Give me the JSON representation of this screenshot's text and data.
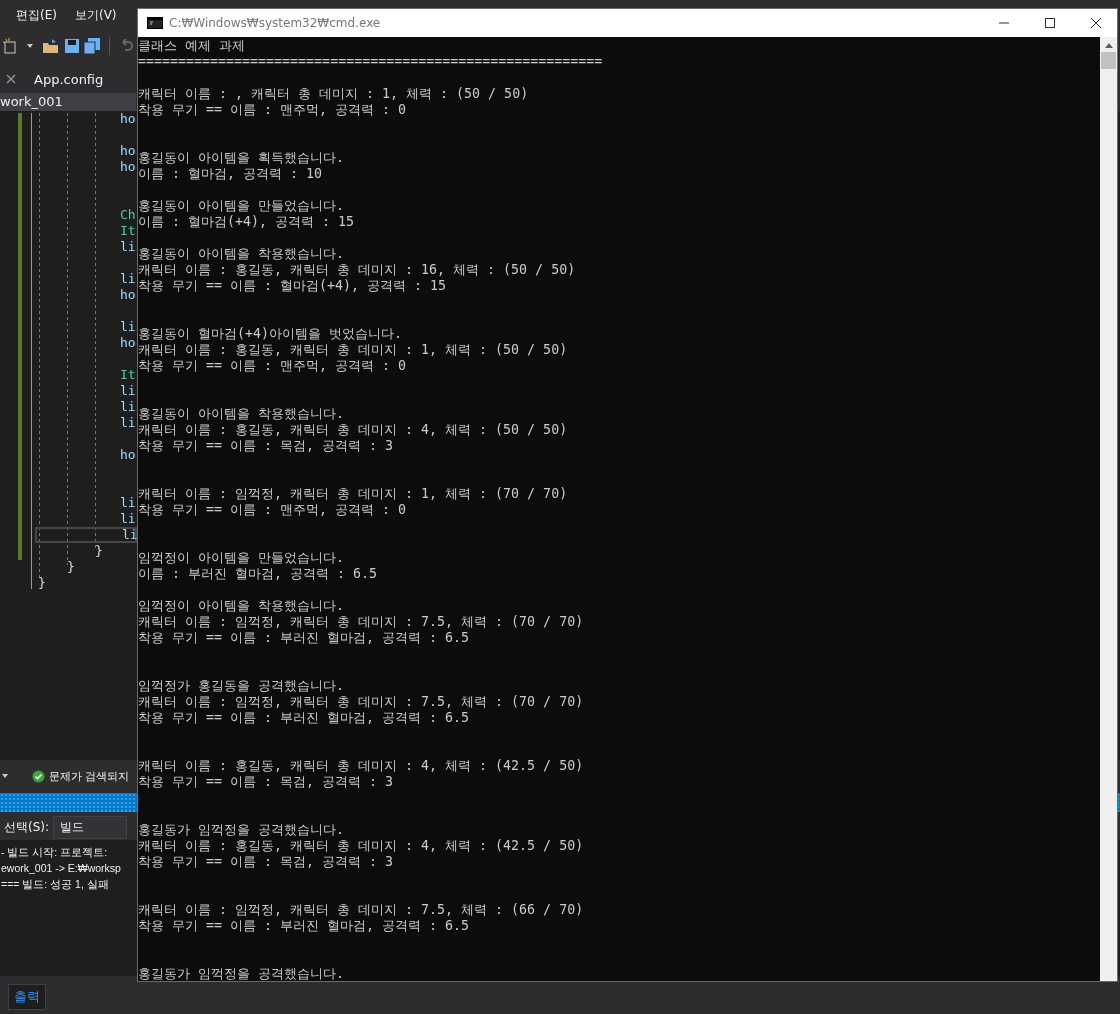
{
  "ide": {
    "menu": [
      "편집(E)",
      "보기(V)"
    ],
    "tabs": [
      {
        "label": "App.config",
        "selected": false
      }
    ],
    "project": "work_001",
    "code_lines": [
      {
        "kind": "ident",
        "text": "ho",
        "current": false
      },
      {
        "kind": "blank",
        "current": false
      },
      {
        "kind": "ident",
        "text": "ho",
        "current": false
      },
      {
        "kind": "ident",
        "text": "ho",
        "current": false
      },
      {
        "kind": "blank",
        "current": false
      },
      {
        "kind": "blank",
        "current": false
      },
      {
        "kind": "type",
        "text": "Ch",
        "current": false
      },
      {
        "kind": "type",
        "text": "It",
        "current": false
      },
      {
        "kind": "ident",
        "text": "li",
        "current": false
      },
      {
        "kind": "blank",
        "current": false
      },
      {
        "kind": "ident",
        "text": "li",
        "current": false
      },
      {
        "kind": "ident",
        "text": "ho",
        "current": false
      },
      {
        "kind": "blank",
        "current": false
      },
      {
        "kind": "ident",
        "text": "li",
        "current": false
      },
      {
        "kind": "ident",
        "text": "ho",
        "current": false
      },
      {
        "kind": "blank",
        "current": false
      },
      {
        "kind": "type",
        "text": "It",
        "current": false
      },
      {
        "kind": "ident",
        "text": "li",
        "current": false
      },
      {
        "kind": "ident",
        "text": "li",
        "current": false
      },
      {
        "kind": "ident",
        "text": "li",
        "current": false
      },
      {
        "kind": "blank",
        "current": false
      },
      {
        "kind": "ident",
        "text": "ho",
        "current": false
      },
      {
        "kind": "blank",
        "current": false
      },
      {
        "kind": "blank",
        "current": false
      },
      {
        "kind": "ident",
        "text": "li",
        "current": false
      },
      {
        "kind": "ident",
        "text": "li",
        "current": false
      },
      {
        "kind": "ident",
        "text": "li",
        "current": true
      },
      {
        "kind": "close-method",
        "text": "}",
        "current": false
      },
      {
        "kind": "close-class",
        "text": "}",
        "current": false
      },
      {
        "kind": "close-namespace",
        "text": "}",
        "current": false
      }
    ],
    "error_status": "문제가 검색되지",
    "output": {
      "source_label": "선택(S):",
      "source_value": "빌드",
      "lines": [
        "- 빌드 시작: 프로젝트:",
        "ework_001 -> E:₩worksp",
        "=== 빌드: 성공 1, 실패"
      ]
    },
    "bottom_tabs": [
      {
        "label": "출력",
        "selected": true
      }
    ]
  },
  "console": {
    "title": "C:₩Windows₩system32₩cmd.exe",
    "lines": [
      {
        "kind": "title",
        "text": "클래스 예제 과제"
      },
      {
        "kind": "rule",
        "text": "=========================================================="
      },
      {
        "kind": "status",
        "text": "캐릭터 이름 : , 캐릭터 총 데미지 : 1, 체력 : (50 / 50)"
      },
      {
        "kind": "weapon",
        "text": "착용 무기 == 이름 : 맨주먹, 공격력 : 0"
      },
      {
        "kind": "event",
        "text": "홍길동이 아이템을 획득했습니다."
      },
      {
        "kind": "item",
        "text": "이름 : 혈마검, 공격력 : 10"
      },
      {
        "kind": "event",
        "text": "홍길동이 아이템을 만들었습니다."
      },
      {
        "kind": "item",
        "text": "이름 : 혈마검(+4), 공격력 : 15"
      },
      {
        "kind": "event",
        "text": "홍길동이 아이템을 착용했습니다."
      },
      {
        "kind": "status",
        "text": "캐릭터 이름 : 홍길동, 캐릭터 총 데미지 : 16, 체력 : (50 / 50)"
      },
      {
        "kind": "weapon",
        "text": "착용 무기 == 이름 : 혈마검(+4), 공격력 : 15"
      },
      {
        "kind": "event",
        "text": "홍길동이 혈마검(+4)아이템을 벗었습니다."
      },
      {
        "kind": "status",
        "text": "캐릭터 이름 : 홍길동, 캐릭터 총 데미지 : 1, 체력 : (50 / 50)"
      },
      {
        "kind": "weapon",
        "text": "착용 무기 == 이름 : 맨주먹, 공격력 : 0"
      },
      {
        "kind": "event",
        "text": "홍길동이 아이템을 착용했습니다."
      },
      {
        "kind": "status",
        "text": "캐릭터 이름 : 홍길동, 캐릭터 총 데미지 : 4, 체력 : (50 / 50)"
      },
      {
        "kind": "weapon",
        "text": "착용 무기 == 이름 : 목검, 공격력 : 3"
      },
      {
        "kind": "status",
        "text": "캐릭터 이름 : 임꺽정, 캐릭터 총 데미지 : 1, 체력 : (70 / 70)"
      },
      {
        "kind": "weapon",
        "text": "착용 무기 == 이름 : 맨주먹, 공격력 : 0"
      },
      {
        "kind": "event",
        "text": "임꺽정이 아이템을 만들었습니다."
      },
      {
        "kind": "item",
        "text": "이름 : 부러진 혈마검, 공격력 : 6.5"
      },
      {
        "kind": "event",
        "text": "임꺽정이 아이템을 착용했습니다."
      },
      {
        "kind": "status",
        "text": "캐릭터 이름 : 임꺽정, 캐릭터 총 데미지 : 7.5, 체력 : (70 / 70)"
      },
      {
        "kind": "weapon",
        "text": "착용 무기 == 이름 : 부러진 혈마검, 공격력 : 6.5"
      },
      {
        "kind": "event",
        "text": "임꺽정가 홍길동을 공격했습니다."
      },
      {
        "kind": "status",
        "text": "캐릭터 이름 : 임꺽정, 캐릭터 총 데미지 : 7.5, 체력 : (70 / 70)"
      },
      {
        "kind": "weapon",
        "text": "착용 무기 == 이름 : 부러진 혈마검, 공격력 : 6.5"
      },
      {
        "kind": "status",
        "text": "캐릭터 이름 : 홍길동, 캐릭터 총 데미지 : 4, 체력 : (42.5 / 50)"
      },
      {
        "kind": "weapon",
        "text": "착용 무기 == 이름 : 목검, 공격력 : 3"
      },
      {
        "kind": "event",
        "text": "홍길동가 임꺽정을 공격했습니다."
      },
      {
        "kind": "status",
        "text": "캐릭터 이름 : 홍길동, 캐릭터 총 데미지 : 4, 체력 : (42.5 / 50)"
      },
      {
        "kind": "weapon",
        "text": "착용 무기 == 이름 : 목검, 공격력 : 3"
      },
      {
        "kind": "status",
        "text": "캐릭터 이름 : 임꺽정, 캐릭터 총 데미지 : 7.5, 체력 : (66 / 70)"
      },
      {
        "kind": "weapon",
        "text": "착용 무기 == 이름 : 부러진 혈마검, 공격력 : 6.5"
      },
      {
        "kind": "event",
        "text": "홍길동가 임꺽정을 공격했습니다."
      }
    ]
  }
}
